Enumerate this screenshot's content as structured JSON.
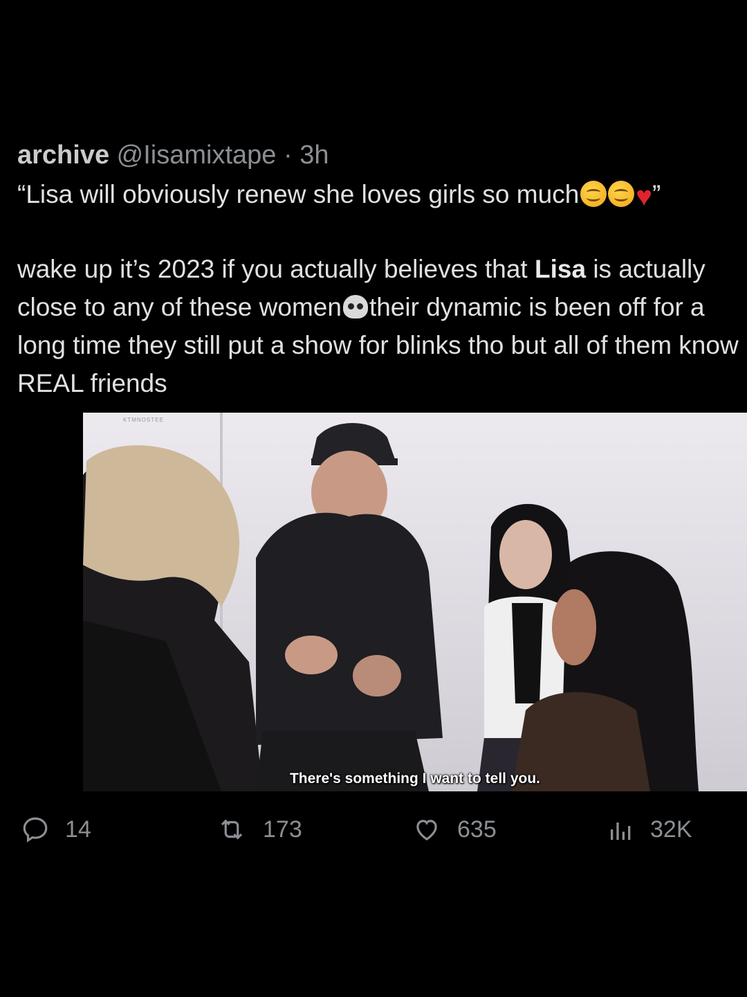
{
  "tweet": {
    "display_name": "archive",
    "handle": "@Iisamixtape",
    "separator": "·",
    "time": "3h",
    "quote_before_emoji": "“Lisa will obviously renew she loves girls so much",
    "quote_end": "”",
    "line1_a": "wake up it’s 2023 if you actually believes that ",
    "line1_bold": "Lisa",
    "line1_b": " is actually",
    "line2_a": "close to any of these women",
    "line2_b": "their dynamic is been off for a",
    "line3": "long time they still put a show for blinks tho but all of them know",
    "line4": "REAL friends"
  },
  "media": {
    "subtitle": "There's something I want to tell you.",
    "watermark": "KTMNOSTEE"
  },
  "actions": {
    "reply_count": "14",
    "retweet_count": "173",
    "like_count": "635",
    "views_count": "32K"
  },
  "icons": [
    "reply-icon",
    "retweet-icon",
    "like-icon",
    "views-icon",
    "smiling-face-emoji",
    "red-heart-emoji",
    "skull-emoji"
  ],
  "colors": {
    "background": "#000000",
    "text": "#e7e9ea",
    "muted": "#8b8f93",
    "heart": "#e0242f"
  }
}
